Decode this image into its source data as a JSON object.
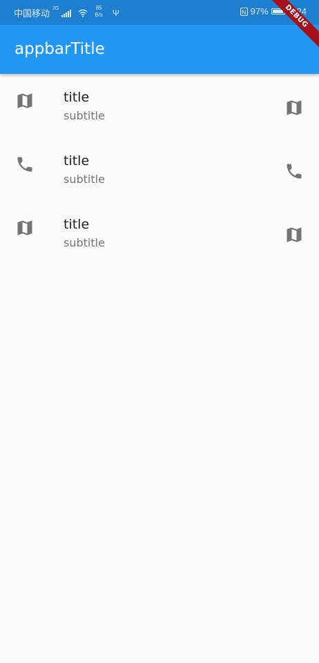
{
  "status_bar": {
    "carrier": "中国移动",
    "network_tag": "2G",
    "speed_value": "85",
    "speed_unit": "B/s",
    "battery_percent": "97%",
    "time": "3:24"
  },
  "debug_banner": "DEBUG",
  "app_bar": {
    "title": "appbarTitle"
  },
  "list": {
    "items": [
      {
        "title": "title",
        "subtitle": "subtitle",
        "leading_icon": "map-icon",
        "trailing_icon": "map-icon"
      },
      {
        "title": "title",
        "subtitle": "subtitle",
        "leading_icon": "phone-icon",
        "trailing_icon": "phone-icon"
      },
      {
        "title": "title",
        "subtitle": "subtitle",
        "leading_icon": "map-icon",
        "trailing_icon": "map-icon"
      }
    ]
  },
  "colors": {
    "status_bar": "#1e7fd0",
    "app_bar": "#2196f3",
    "background": "#fafafa",
    "icon": "#757575",
    "debug_ribbon": "#a5101b"
  }
}
